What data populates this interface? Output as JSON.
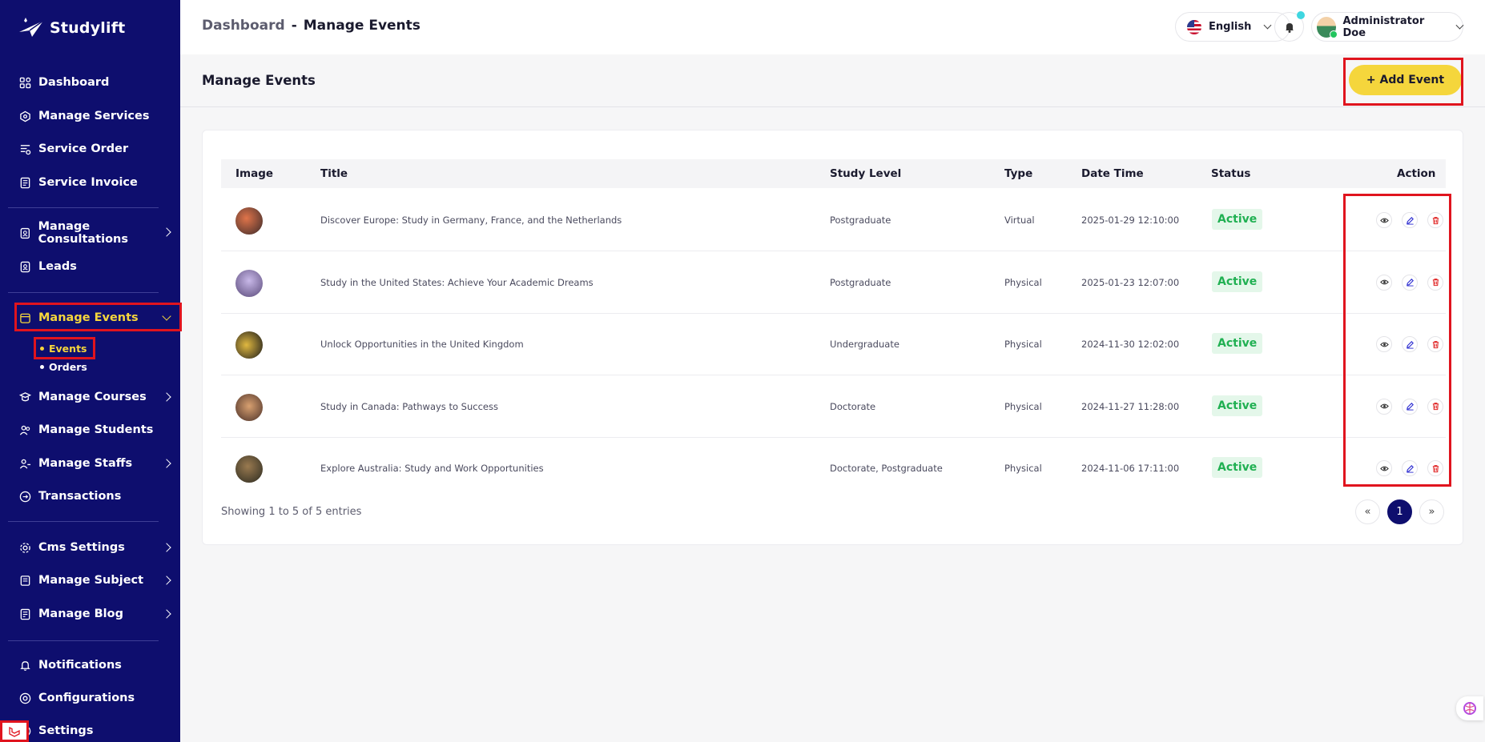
{
  "app": {
    "name": "Studylift"
  },
  "sidebar": {
    "items": [
      {
        "label": "Dashboard",
        "icon": "dashboard-icon"
      },
      {
        "label": "Manage Services",
        "icon": "services-icon"
      },
      {
        "label": "Service Order",
        "icon": "order-icon"
      },
      {
        "label": "Service Invoice",
        "icon": "invoice-icon"
      },
      {
        "label": "Manage Consultations",
        "icon": "consultation-icon"
      },
      {
        "label": "Leads",
        "icon": "leads-icon"
      },
      {
        "label": "Manage Events",
        "icon": "calendar-icon"
      },
      {
        "label": "Manage Courses",
        "icon": "courses-icon"
      },
      {
        "label": "Manage Students",
        "icon": "students-icon"
      },
      {
        "label": "Manage Staffs",
        "icon": "staffs-icon"
      },
      {
        "label": "Transactions",
        "icon": "transactions-icon"
      },
      {
        "label": "Cms Settings",
        "icon": "cms-icon"
      },
      {
        "label": "Manage Subject",
        "icon": "subject-icon"
      },
      {
        "label": "Manage Blog",
        "icon": "blog-icon"
      },
      {
        "label": "Notifications",
        "icon": "bell-icon"
      },
      {
        "label": "Configurations",
        "icon": "config-icon"
      },
      {
        "label": "Settings",
        "icon": "settings-icon"
      }
    ],
    "sub_items": [
      {
        "label": "Events"
      },
      {
        "label": "Orders"
      }
    ]
  },
  "topbar": {
    "breadcrumb_root": "Dashboard",
    "breadcrumb_sep": "-",
    "breadcrumb_current": "Manage Events",
    "language": "English",
    "user_name": "Administrator Doe"
  },
  "page": {
    "title": "Manage Events",
    "add_button": "+ Add Event"
  },
  "table": {
    "columns": [
      "Image",
      "Title",
      "Study Level",
      "Type",
      "Date Time",
      "Status",
      "Action"
    ],
    "rows": [
      {
        "title": "Discover Europe: Study in Germany, France, and the Netherlands",
        "study_level": "Postgraduate",
        "type": "Virtual",
        "datetime": "2025-01-29 12:10:00",
        "status": "Active"
      },
      {
        "title": "Study in the United States: Achieve Your Academic Dreams",
        "study_level": "Postgraduate",
        "type": "Physical",
        "datetime": "2025-01-23 12:07:00",
        "status": "Active"
      },
      {
        "title": "Unlock Opportunities in the United Kingdom",
        "study_level": "Undergraduate",
        "type": "Physical",
        "datetime": "2024-11-30 12:02:00",
        "status": "Active"
      },
      {
        "title": "Study in Canada: Pathways to Success",
        "study_level": "Doctorate",
        "type": "Physical",
        "datetime": "2024-11-27 11:28:00",
        "status": "Active"
      },
      {
        "title": "Explore Australia: Study and Work Opportunities",
        "study_level": "Doctorate, Postgraduate",
        "type": "Physical",
        "datetime": "2024-11-06 17:11:00",
        "status": "Active"
      }
    ]
  },
  "pagination": {
    "showing": "Showing 1 to 5 of 5 entries",
    "prev": "«",
    "current": "1",
    "next": "»"
  },
  "colors": {
    "sidebar_bg": "#0e0e6e",
    "accent_yellow": "#f5d63c",
    "status_green": "#20b052",
    "highlight_red": "#e0141e"
  }
}
